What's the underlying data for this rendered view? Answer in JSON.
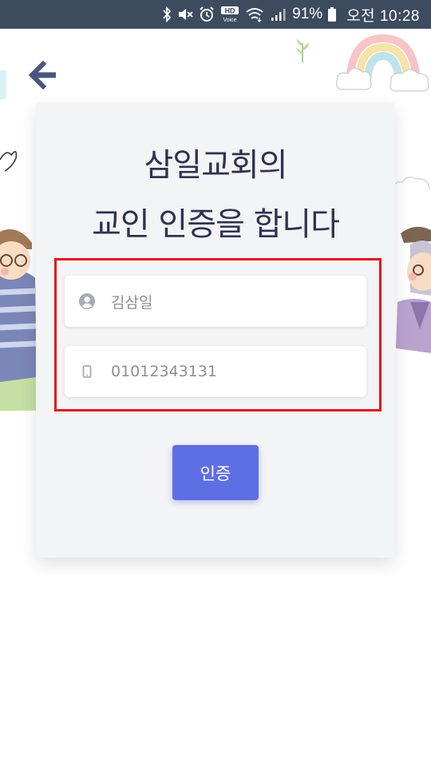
{
  "status_bar": {
    "battery": "91%",
    "time": "오전 10:28",
    "icons": [
      "bluetooth-icon",
      "mute-icon",
      "alarm-icon",
      "hd-voice-icon",
      "wifi-icon",
      "signal-icon",
      "battery-icon"
    ],
    "hd_label": "HD",
    "voice_label": "Voice"
  },
  "navigation": {
    "back_icon": "arrow-left-icon"
  },
  "card": {
    "title_line1": "삼일교회의",
    "title_line2": "교인 인증을 합니다",
    "name_field": {
      "value": "김삼일",
      "icon": "user-circle-icon"
    },
    "phone_field": {
      "value": "01012343131",
      "icon": "phone-icon"
    },
    "submit_label": "인증"
  },
  "colors": {
    "status_bar": "#3d4b5f",
    "card_bg": "#f3f4f6",
    "title": "#2e3250",
    "primary": "#5e6fe3",
    "highlight": "#e0161d",
    "back_arrow": "#4a5580"
  }
}
